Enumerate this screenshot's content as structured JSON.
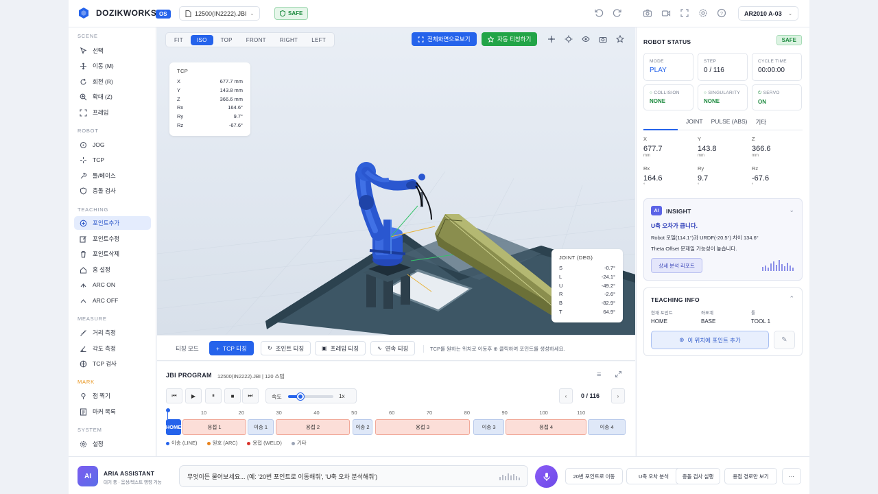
{
  "brand": {
    "name": "DOZIKWORKS",
    "badge": "OS"
  },
  "topbar": {
    "file_name": "12500(IN2222).JBI",
    "safe_label": "SAFE",
    "robot_model": "AR2010 A-03"
  },
  "sidebar": {
    "scene_title": "SCENE",
    "scene_items": [
      "선택",
      "이동 (M)",
      "회전 (R)",
      "확대 (Z)",
      "프레임"
    ],
    "robot_title": "ROBOT",
    "robot_items": [
      "JOG",
      "TCP",
      "툴/베이스",
      "충돌 검사"
    ],
    "teaching_title": "TEACHING",
    "teaching_items": [
      "포인트추가",
      "포인트수정",
      "포인트삭제",
      "홈 설정",
      "ARC ON",
      "ARC OFF"
    ],
    "measure_title": "MEASURE",
    "measure_items": [
      "거리 측정",
      "각도 측정",
      "TCP 검사"
    ],
    "mark_title": "MARK",
    "mark_items": [
      "점 찍기",
      "마커 목록"
    ],
    "system_title": "SYSTEM",
    "system_items": [
      "설정"
    ]
  },
  "viewport": {
    "views": [
      "FIT",
      "ISO",
      "TOP",
      "FRONT",
      "RIGHT",
      "LEFT"
    ],
    "active_view": "ISO",
    "fullscreen_label": "전체화면으로보기",
    "auto_teach_label": "자동 티칭하기",
    "tcp": {
      "title": "TCP",
      "rows": [
        {
          "k": "X",
          "v": "677.7 mm"
        },
        {
          "k": "Y",
          "v": "143.8 mm"
        },
        {
          "k": "Z",
          "v": "366.6 mm"
        },
        {
          "k": "Rx",
          "v": "164.6°"
        },
        {
          "k": "Ry",
          "v": "9.7°"
        },
        {
          "k": "Rz",
          "v": "-67.6°"
        }
      ]
    },
    "joint": {
      "title": "JOINT (DEG)",
      "rows": [
        {
          "k": "S",
          "v": "-0.7°"
        },
        {
          "k": "L",
          "v": "-24.1°"
        },
        {
          "k": "U",
          "v": "-49.2°"
        },
        {
          "k": "R",
          "v": "-2.6°"
        },
        {
          "k": "B",
          "v": "-82.9°"
        },
        {
          "k": "T",
          "v": "64.9°"
        }
      ]
    }
  },
  "teach_bar": {
    "mode_label": "티칭 모드",
    "tcp_label": "TCP 티칭",
    "joint_label": "조인트 티칭",
    "frame_label": "프레임 티칭",
    "continuous_label": "연속 티칭",
    "hint": "TCP를 원하는 위치로 이동후 ⊕ 클릭하여 포인트를 생성하세요."
  },
  "jbi": {
    "title": "JBI PROGRAM",
    "subtitle": "12500(IN2222).JBI | 120 스텝",
    "speed_label": "속도",
    "speed_value": "1x",
    "speed_fraction": 0.28,
    "counter": "0 / 116",
    "ruler": [
      "10",
      "20",
      "30",
      "40",
      "50",
      "60",
      "70",
      "80",
      "90",
      "100",
      "110"
    ],
    "segments": [
      {
        "label": "HOME",
        "type": "home"
      },
      {
        "label": "용접 1",
        "type": "weld"
      },
      {
        "label": "이송 1",
        "type": "move"
      },
      {
        "label": "용접 2",
        "type": "weld"
      },
      {
        "label": "이송 2",
        "type": "move"
      },
      {
        "label": "용접 3",
        "type": "weld"
      },
      {
        "label": "이송 3",
        "type": "move"
      },
      {
        "label": "용접 4",
        "type": "weld"
      },
      {
        "label": "이송 4",
        "type": "move"
      }
    ],
    "legend": [
      {
        "label": "이송 (LINE)",
        "color": "#2563eb"
      },
      {
        "label": "원호 (ARC)",
        "color": "#e8821c"
      },
      {
        "label": "용접 (WELD)",
        "color": "#d9332b"
      },
      {
        "label": "기타",
        "color": "#9aa3b5"
      }
    ]
  },
  "robot_status": {
    "title": "ROBOT STATUS",
    "safe": "SAFE",
    "mode_label": "MODE",
    "mode": "PLAY",
    "step_label": "STEP",
    "step": "0 / 116",
    "cycle_label": "CYCLE TIME",
    "cycle": "00:00:00",
    "collision_label": "COLLISION",
    "collision": "NONE",
    "singularity_label": "SINGULARITY",
    "singularity": "NONE",
    "servo_label": "SERVO",
    "servo": "ON",
    "tabs": [
      "JOINT",
      "PULSE (ABS)",
      "기타"
    ],
    "coords": [
      {
        "k": "X",
        "v": "677.7",
        "u": "mm"
      },
      {
        "k": "Y",
        "v": "143.8",
        "u": "mm"
      },
      {
        "k": "Z",
        "v": "366.6",
        "u": "mm"
      },
      {
        "k": "Rx",
        "v": "164.6",
        "u": "°"
      },
      {
        "k": "Ry",
        "v": "9.7",
        "u": "°"
      },
      {
        "k": "Rz",
        "v": "-67.6",
        "u": "°"
      }
    ]
  },
  "insight": {
    "badge": "AI",
    "title": "INSIGHT",
    "headline": "U축 오차가 큽니다.",
    "line1": "Robot 모델(114.1°)과 URDF(-20.5°) 차이 134.6°",
    "line2": "Theta Offset 문제일 가능성이 높습니다.",
    "report_label": "상세 분석 리포트"
  },
  "teaching_info": {
    "title": "TEACHING INFO",
    "col1_label": "현재 포인트",
    "col1_value": "HOME",
    "col2_label": "좌표계",
    "col2_value": "BASE",
    "col3_label": "툴",
    "col3_value": "TOOL 1",
    "add_label": "이 위치에 포인트 추가"
  },
  "assistant": {
    "avatar": "AI",
    "name": "ARIA ASSISTANT",
    "status": "대기 중 · 음성/텍스트 명령 가능",
    "placeholder": "무엇이든 물어보세요... (예: '20번 포인트로 이동해줘', 'U축 오차 분석해줘')",
    "quick_actions": [
      "20번 포인트로 이동",
      "U축 오차 분석",
      "충돌 검사 실행",
      "용접 경로만 보기"
    ],
    "more": "⋯"
  }
}
